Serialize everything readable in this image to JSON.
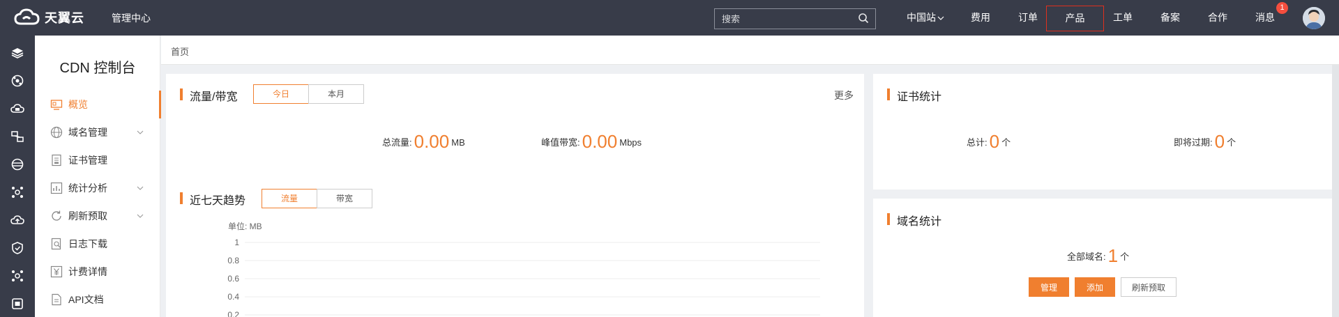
{
  "header": {
    "brand": "天翼云",
    "console_link": "管理中心",
    "search_placeholder": "搜索",
    "nav": [
      {
        "label": "中国站"
      },
      {
        "label": "费用"
      },
      {
        "label": "订单"
      },
      {
        "label": "产品"
      },
      {
        "label": "工单"
      },
      {
        "label": "备案"
      },
      {
        "label": "合作"
      },
      {
        "label": "消息"
      }
    ],
    "message_badge": "1"
  },
  "sidebar": {
    "title": "CDN 控制台",
    "items": [
      {
        "label": "概览"
      },
      {
        "label": "域名管理"
      },
      {
        "label": "证书管理"
      },
      {
        "label": "统计分析"
      },
      {
        "label": "刷新预取"
      },
      {
        "label": "日志下载"
      },
      {
        "label": "计费详情"
      },
      {
        "label": "API文档"
      }
    ]
  },
  "breadcrumb": "首页",
  "traffic": {
    "title": "流量/带宽",
    "tabs": [
      "今日",
      "本月"
    ],
    "more": "更多",
    "total_label": "总流量:",
    "total_value": "0.00",
    "total_unit": "MB",
    "peak_label": "峰值带宽:",
    "peak_value": "0.00",
    "peak_unit": "Mbps"
  },
  "trend": {
    "title": "近七天趋势",
    "tabs": [
      "流量",
      "带宽"
    ]
  },
  "cert": {
    "title": "证书统计",
    "total_label": "总计:",
    "total_value": "0",
    "total_unit": "个",
    "expiring_label": "即将过期:",
    "expiring_value": "0",
    "expiring_unit": "个"
  },
  "domain": {
    "title": "域名统计",
    "all_label": "全部域名:",
    "all_value": "1",
    "all_unit": "个",
    "buttons": [
      "管理",
      "添加",
      "刷新预取"
    ]
  },
  "colors": {
    "accent": "#f07f2f",
    "topbar": "#383c49",
    "badge": "#f54e3e"
  },
  "chart_data": {
    "type": "line",
    "ylabel": "单位: MB",
    "yticks": [
      "1",
      "0.8",
      "0.6",
      "0.4",
      "0.2"
    ],
    "ylim": [
      0,
      1
    ],
    "grid": true,
    "series": []
  }
}
